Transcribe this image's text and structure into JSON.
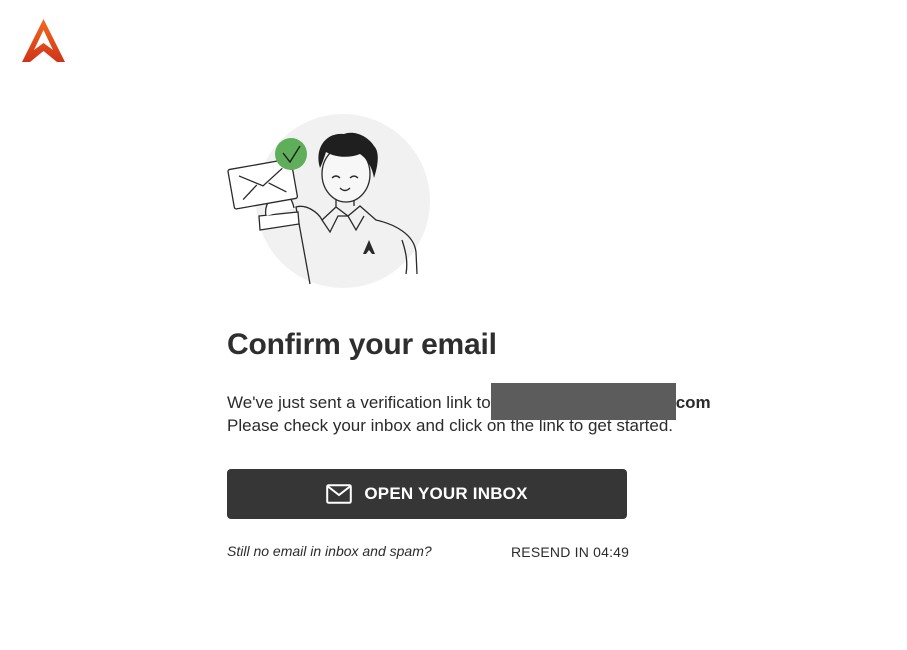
{
  "brand": {
    "logo_icon": "brand-a-logo-icon",
    "logo_color_top": "#f0571e",
    "logo_color_bottom": "#c8321b"
  },
  "illustration": {
    "icon": "person-holding-envelope-illustration",
    "check_badge_color": "#5fae5a",
    "circle_color": "#f1f1f1"
  },
  "heading": "Confirm your email",
  "message": {
    "line1_prefix": "We've just sent a verification link to",
    "email_suffix": "com",
    "line2": "Please check your inbox and click on the link to get started."
  },
  "cta": {
    "label": "OPEN YOUR INBOX",
    "icon": "envelope-icon",
    "bg_color": "#363636"
  },
  "footer": {
    "question": "Still no email in inbox and spam?",
    "resend_label": "RESEND IN 04:49"
  }
}
